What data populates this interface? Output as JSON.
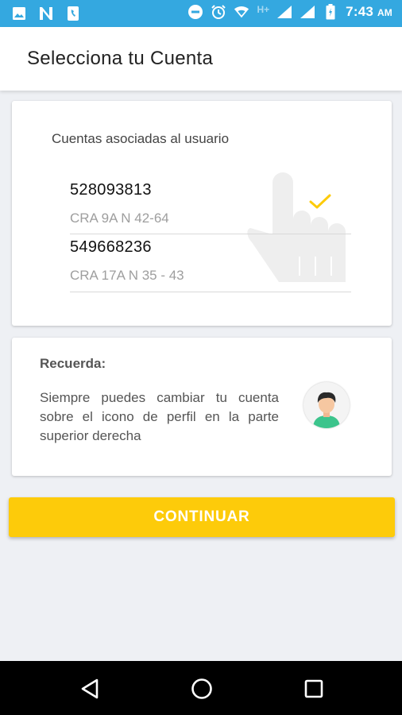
{
  "status_bar": {
    "time": "7:43",
    "ampm": "AM",
    "network": "H+",
    "left_icons": [
      "image-icon",
      "n-app-icon",
      "phone-doc-icon"
    ],
    "right_icons": [
      "do-not-disturb-icon",
      "alarm-icon",
      "wifi-icon",
      "signal-icon",
      "signal-icon",
      "battery-icon"
    ]
  },
  "header": {
    "title": "Selecciona tu Cuenta"
  },
  "accounts_card": {
    "heading": "Cuentas asociadas al usuario",
    "accounts": [
      {
        "number": "528093813",
        "address": "CRA 9A N 42-64",
        "selected": true
      },
      {
        "number": "549668236",
        "address": "CRA 17A N 35 - 43",
        "selected": false
      }
    ]
  },
  "reminder_card": {
    "title": "Recuerda:",
    "text": "Siempre puedes cambiar tu cuenta sobre el icono de perfil en la parte superior derecha"
  },
  "continue_button": {
    "label": "CONTINUAR"
  },
  "colors": {
    "status_bar": "#34a8e0",
    "accent": "#fdcb0a",
    "background": "#eef0f4"
  },
  "nav_bar": {
    "buttons": [
      "back-icon",
      "home-icon",
      "recents-icon"
    ]
  }
}
